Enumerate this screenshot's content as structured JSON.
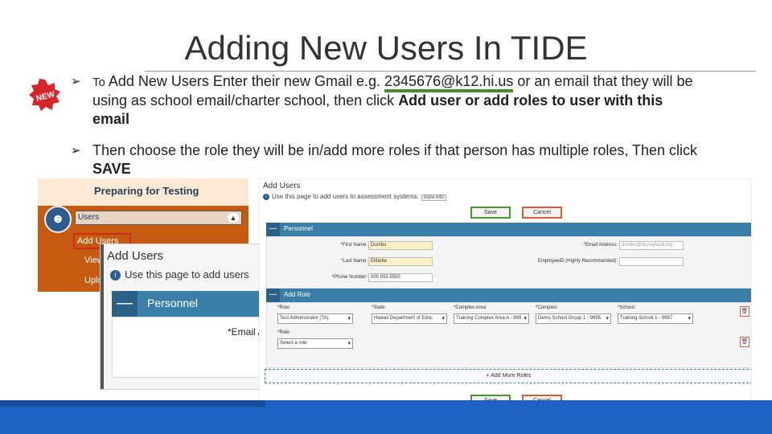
{
  "slide": {
    "title": "Adding New Users In TIDE",
    "badge_text": "NEW",
    "bullet1": {
      "prefix": "To",
      "text1": " Add New Users Enter their new Gmail e.g. ",
      "email": "2345676@k12.hi.us",
      "text2": " or an email that they will be using as school email/charter school, then click ",
      "bold": "Add user or add roles to user with this email"
    },
    "bullet2": {
      "text": "Then choose the role they will be in/add more roles if that person has multiple roles, Then click ",
      "bold": "SAVE"
    }
  },
  "left_shot": {
    "heading": "Preparing for Testing",
    "users_field": "Users",
    "add_users": "Add Users",
    "view": "View",
    "upload": "Uplo"
  },
  "popup": {
    "title": "Add Users",
    "help": "Use this page to add users",
    "section": "Personnel",
    "email_label": "*Email A"
  },
  "right_shot": {
    "title": "Add Users",
    "help": "Use this page to add users to assessment systems.",
    "more_info": "more info",
    "save": "Save",
    "cancel": "Cancel",
    "personnel": "Personnel",
    "first_name_label": "*First Name:",
    "first_name_value": "Dumbo",
    "last_name_label": "*Last Name:",
    "last_name_value": "Elifante",
    "phone_label": "*Phone Number:",
    "phone_value": "000 555 5555",
    "email_label": "*Email Address:",
    "email_value": "dumbo@disneyland.org",
    "employee_label": "EmployeeID (Highly Recommended):",
    "add_role": "Add Role",
    "role_label": "*Role:",
    "role_value": "Test Administrator (TA)",
    "state_label": "*State:",
    "state_value": "Hawaii Department of Educ",
    "complex_area_label": "*Complex Area:",
    "complex_area_value": "Training Complex Area A - 999",
    "complex_label": "*Complex:",
    "complex_value": "Demo School Group 1 - 9995",
    "school_label": "*School:",
    "school_value": "Training School 1 - 9997",
    "role2_label": "*Role:",
    "role2_value": "Select a role",
    "add_more_roles": "+ Add More Roles"
  },
  "colors": {
    "accent_blue": "#1f60c3",
    "section_blue": "#3b7fa8",
    "orange": "#c55a11",
    "email_underline": "#4a8c2a"
  }
}
